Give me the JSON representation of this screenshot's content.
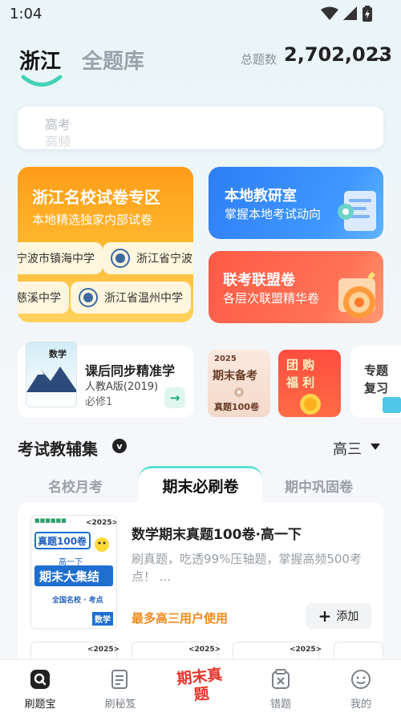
{
  "status_bar": {
    "time": "1:04"
  },
  "top_nav": {
    "region_tab": "浙江",
    "all_bank_tab": "全题库",
    "total_label": "总题数",
    "total_value": "2,702,023",
    "total_arrow": "→"
  },
  "search": {
    "placeholder_line1": "高考",
    "placeholder_line2": "高频"
  },
  "zhejiang_card": {
    "title": "浙江名校试卷专区",
    "subtitle": "本地精选独家内部试卷",
    "schools": [
      "宁波市镇海中学",
      "浙江省宁波中",
      "慈溪中学",
      "浙江省温州中学"
    ]
  },
  "research_card": {
    "title": "本地教研室",
    "subtitle": "掌握本地考试动向"
  },
  "joint_card": {
    "title": "联考联盟卷",
    "subtitle": "各层次联盟精华卷"
  },
  "sync_card": {
    "book_label": "数学",
    "title": "课后同步精准学",
    "edition": "人教A版(2019)",
    "volume": "必修1",
    "arrow": "→"
  },
  "promo_final": {
    "year": "2025",
    "title": "期末备考",
    "sub": "真题100卷"
  },
  "promo_group": {
    "line1": "团 购",
    "line2": "福 利"
  },
  "promo_topic": {
    "line1": "专题",
    "line2": "复习"
  },
  "section": {
    "title": "考试教辅集",
    "badge": "v",
    "grade": "高三"
  },
  "subtabs": {
    "left": "名校月考",
    "active": "期末必刷卷",
    "right": "期中巩固卷"
  },
  "book": {
    "cover_brand": "■■■■■■",
    "cover_year": "<2025>",
    "cover_line1": "真题100卷",
    "cover_grade": "高一下",
    "cover_line2": "期末大集结",
    "cover_footer": "全国名校 · 考点",
    "cover_subject": "数学",
    "title": "数学期末真题100卷·高一下",
    "description": "刷真题，吃透99%压轴题，掌握高频500考点！ ...",
    "users": "最多高三用户使用",
    "add_label": "添加"
  },
  "mini_covers": [
    "<2025>",
    "<2025>",
    "<2025>"
  ],
  "bottom_nav": [
    {
      "label": "刷题宝",
      "active": true
    },
    {
      "label": "刷秘笈",
      "active": false
    },
    {
      "label": "期末真题",
      "active": false
    },
    {
      "label": "错题",
      "active": false
    },
    {
      "label": "我的",
      "active": false
    }
  ],
  "colors": {
    "accent_teal": "#5ce0cf",
    "orange": "#ff9c1a",
    "blue": "#2e7df5",
    "red": "#ff5a45"
  }
}
